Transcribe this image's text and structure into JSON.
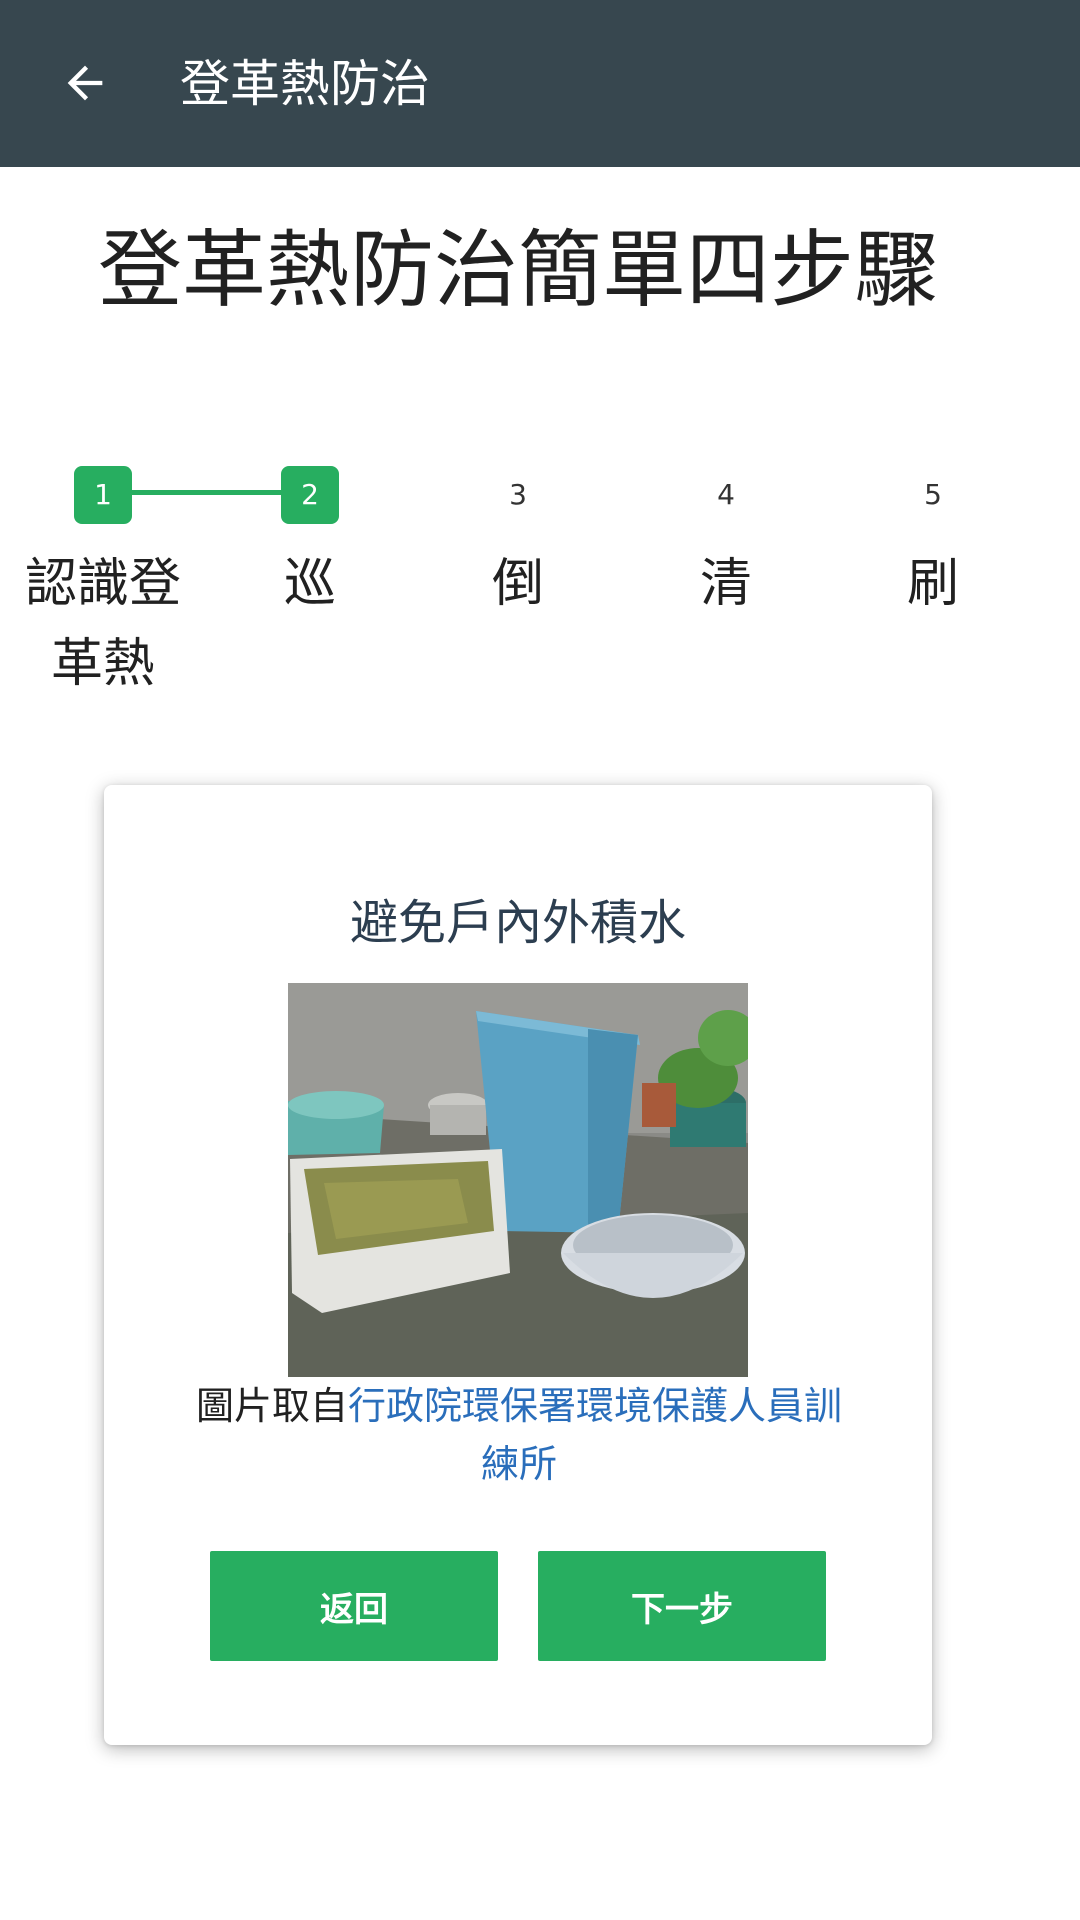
{
  "appbar": {
    "title": "登革熱防治",
    "back_icon": "arrow-left-icon",
    "background": "#37474f"
  },
  "page": {
    "title": "登革熱防治簡單四步驟"
  },
  "stepper": {
    "accent": "#27ae60",
    "steps": [
      {
        "number": "1",
        "label": "認識登革熱",
        "completed": true
      },
      {
        "number": "2",
        "label": "巡",
        "completed": true
      },
      {
        "number": "3",
        "label": "倒",
        "completed": false
      },
      {
        "number": "4",
        "label": "清",
        "completed": false
      },
      {
        "number": "5",
        "label": "刷",
        "completed": false
      }
    ]
  },
  "card": {
    "title": "避免戶內外積水",
    "caption_prefix": "圖片取自",
    "caption_link": "行政院環保署環境保護人員訓練所",
    "buttons": {
      "back": "返回",
      "next": "下一步"
    }
  }
}
